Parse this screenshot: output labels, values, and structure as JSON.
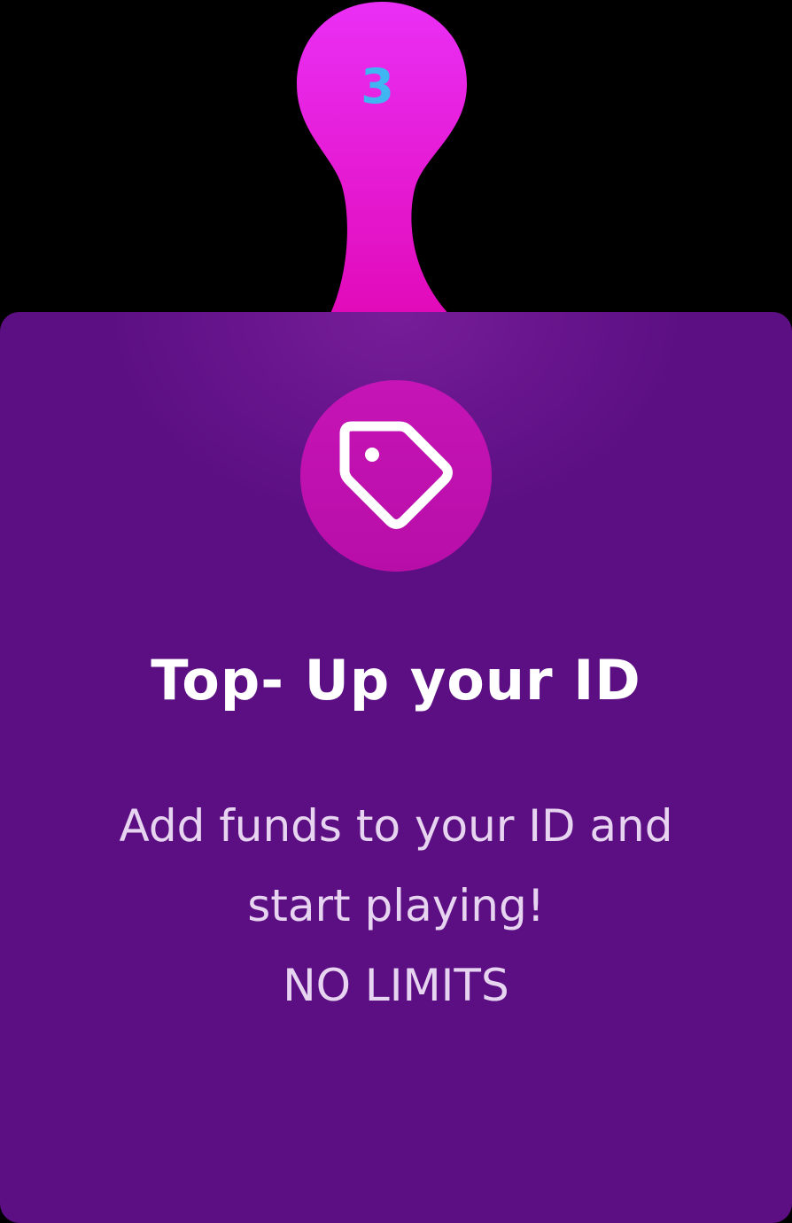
{
  "step": {
    "number": "3",
    "number_color": "#3fb6f2",
    "tab_gradient": [
      "#ea2ff5",
      "#e10ab8"
    ]
  },
  "card": {
    "background": "#5c0f83",
    "icon": "price-tag-icon",
    "title": "Top- Up your ID",
    "description_lines": [
      "Add funds to your ID and",
      "start playing!",
      "NO LIMITS"
    ]
  }
}
